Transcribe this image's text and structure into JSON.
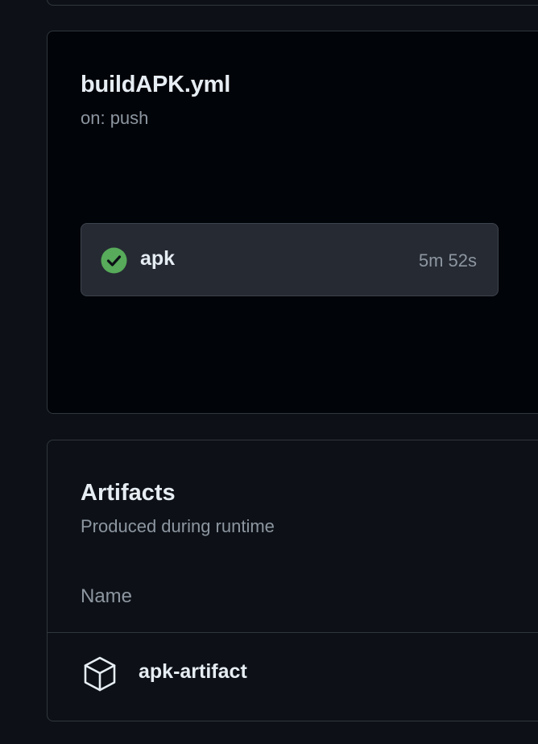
{
  "workflow": {
    "title": "buildAPK.yml",
    "trigger": "on: push",
    "job": {
      "name": "apk",
      "duration": "5m 52s",
      "status": "success",
      "status_icon": "check-circle-icon",
      "status_color": "#57ab5a"
    }
  },
  "artifacts": {
    "title": "Artifacts",
    "subtitle": "Produced during runtime",
    "column_header": "Name",
    "items": [
      {
        "name": "apk-artifact",
        "icon": "package-icon"
      }
    ]
  }
}
